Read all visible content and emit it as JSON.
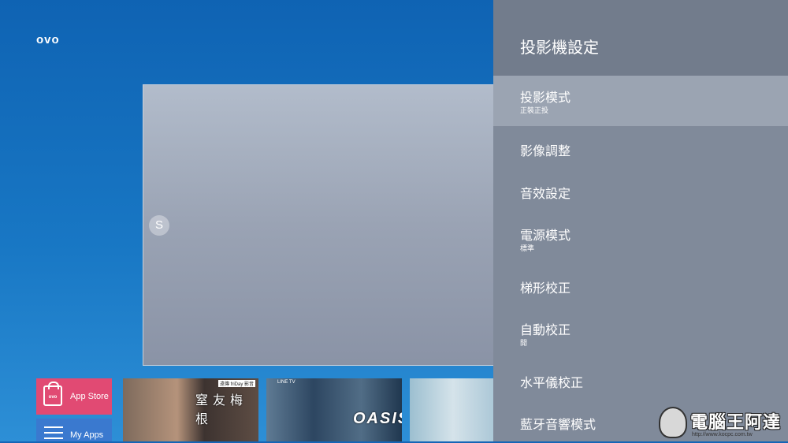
{
  "brand": {
    "logo": "ovo"
  },
  "hero": {
    "badge": "S"
  },
  "apps": [
    {
      "label": "App Store",
      "icon": "shopping-bag-icon",
      "icon_text": "ovo",
      "color": "#e14a73"
    },
    {
      "label": "My Apps",
      "icon": "list-icon",
      "color": "#3a79cf"
    }
  ],
  "posters": [
    {
      "title": "窒友梅根",
      "tag": "遠傳 friDay 影音"
    },
    {
      "title": "OASIS",
      "tag": "LINE TV"
    },
    {
      "title": ""
    }
  ],
  "settings": {
    "title": "投影機設定",
    "items": [
      {
        "label": "投影模式",
        "sub": "正裝正投",
        "selected": true
      },
      {
        "label": "影像調整",
        "sub": ""
      },
      {
        "label": "音效設定",
        "sub": ""
      },
      {
        "label": "電源模式",
        "sub": "標準"
      },
      {
        "label": "梯形校正",
        "sub": ""
      },
      {
        "label": "自動校正",
        "sub": "開"
      },
      {
        "label": "水平儀校正",
        "sub": ""
      },
      {
        "label": "藍牙音響模式",
        "sub": ""
      }
    ]
  },
  "watermark": {
    "text": "電腦王阿達",
    "url": "http://www.kocpc.com.tw"
  }
}
